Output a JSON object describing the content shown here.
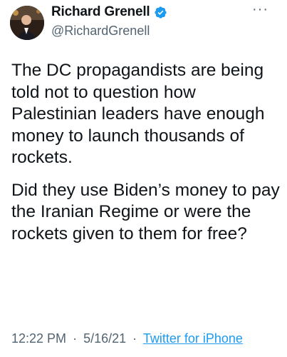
{
  "author": {
    "name": "Richard Grenell",
    "handle": "@RichardGrenell",
    "verified": true,
    "verified_color": "#1d9bf0"
  },
  "tweet": {
    "paragraphs": [
      "The DC propagandists are being told not to question how Palestinian leaders have enough money to launch thousands of rockets.",
      "Did they use Biden’s money to pay the Iranian Regime or were the rockets given to them for free?"
    ]
  },
  "meta": {
    "time": "12:22 PM",
    "separator": "·",
    "date": "5/16/21",
    "source": "Twitter for iPhone"
  },
  "icons": {
    "more": "more-options-icon",
    "verified": "verified-badge-icon"
  },
  "colors": {
    "text": "#0f1419",
    "secondary": "#536471",
    "link": "#1d9bf0"
  }
}
